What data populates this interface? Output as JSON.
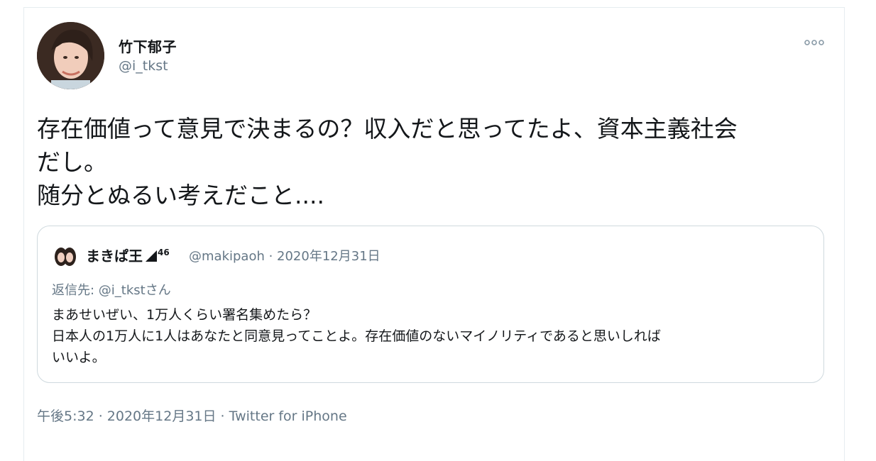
{
  "author": {
    "display_name": "竹下郁子",
    "handle": "@i_tkst"
  },
  "tweet": {
    "text": "存在価値って意見で決まるの？収入だと思ってたよ、資本主義社会\nだし。\n随分とぬるい考えだこと...."
  },
  "quoted_tweet": {
    "display_name": "まきぱ王",
    "name_superscript": "46",
    "meta": "@makipaoh · 2020年12月31日",
    "reply_to": "返信先: @i_tkstさん",
    "text": "まあせいぜい、1万人くらい署名集めたら？\n日本人の1万人に1人はあなたと同意見ってことよ。存在価値のないマイノリティであると思いしれば\nいいよ。"
  },
  "footer": {
    "time": "午後5:32 · 2020年12月31日",
    "separator": "·",
    "source": "Twitter for iPhone"
  },
  "icons": {
    "more": "more-options-icon",
    "signal": "signal-icon"
  },
  "colors": {
    "text_primary": "#14171a",
    "text_secondary": "#657786",
    "border": "#cfd9de"
  }
}
